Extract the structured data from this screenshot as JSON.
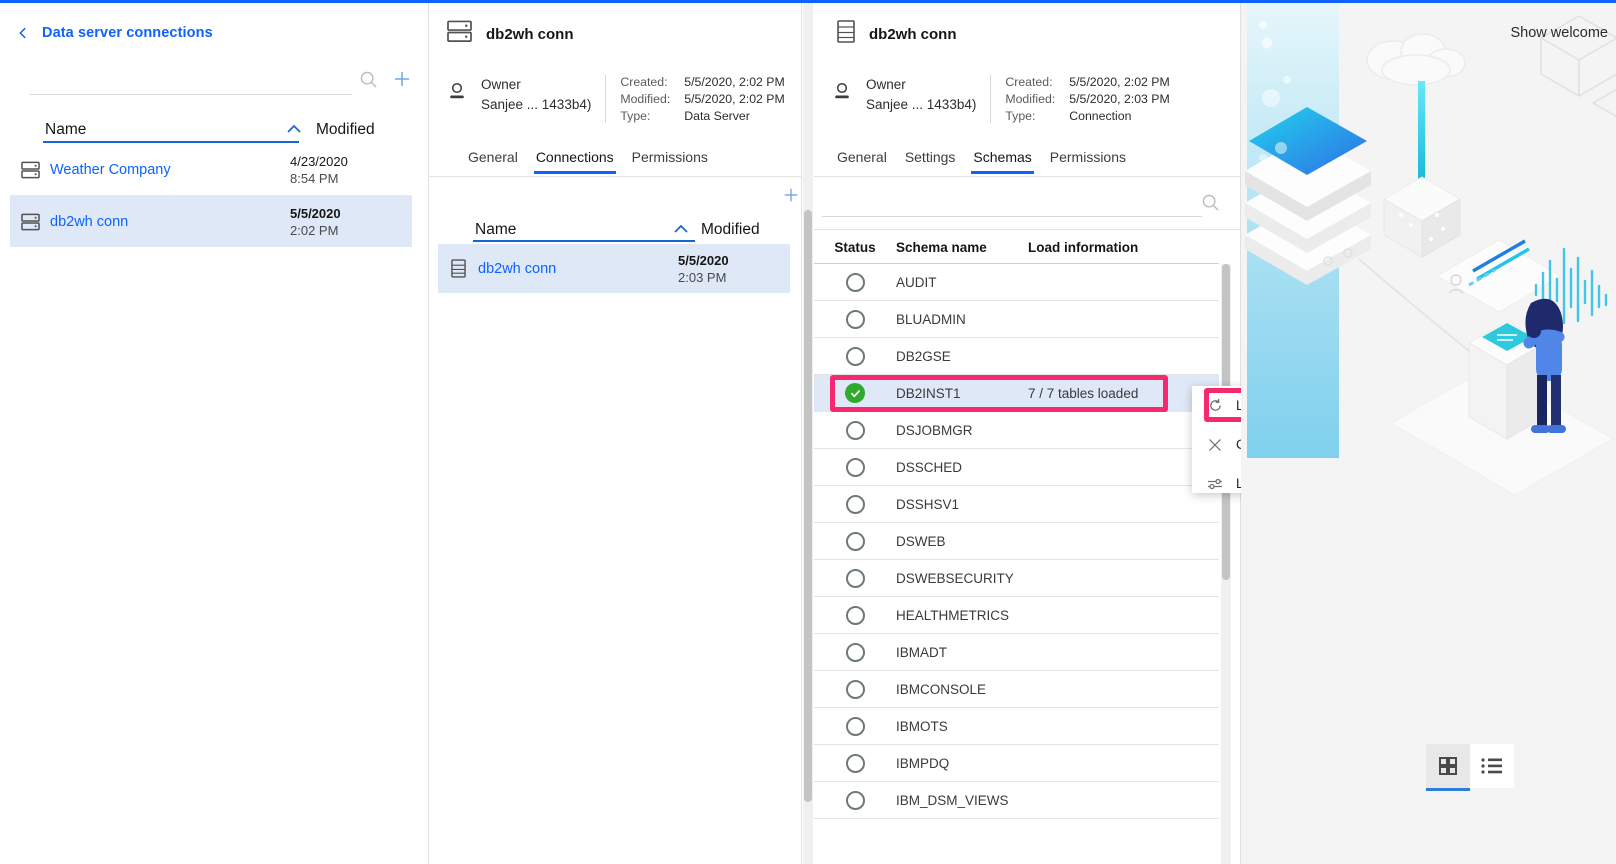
{
  "accent": {
    "blue": "#0f62fe",
    "highlight_pink": "#f6286e",
    "row_select": "#dfe8f7",
    "status_green": "#2faa2f"
  },
  "panel_connections": {
    "breadcrumb_label": "Data server connections",
    "search_placeholder": "",
    "search_value": "",
    "columns": {
      "name": "Name",
      "modified": "Modified"
    },
    "rows": [
      {
        "icon": "data-server-icon",
        "name": "Weather Company",
        "date": "4/23/2020",
        "time": "8:54 PM",
        "selected": false
      },
      {
        "icon": "data-server-icon",
        "name": "db2wh conn",
        "date": "5/5/2020",
        "time": "2:02 PM",
        "selected": true
      }
    ]
  },
  "panel_dataserver": {
    "title": "db2wh conn",
    "owner_label": "Owner",
    "owner_value": "Sanjee ... 1433b4)",
    "meta": [
      {
        "key": "Created:",
        "value": "5/5/2020, 2:02 PM"
      },
      {
        "key": "Modified:",
        "value": "5/5/2020, 2:02 PM"
      },
      {
        "key": "Type:",
        "value": "Data Server"
      }
    ],
    "tabs": [
      {
        "label": "General",
        "active": false
      },
      {
        "label": "Connections",
        "active": true
      },
      {
        "label": "Permissions",
        "active": false
      }
    ],
    "columns": {
      "name": "Name",
      "modified": "Modified"
    },
    "rows": [
      {
        "icon": "connection-icon",
        "name": "db2wh conn",
        "date": "5/5/2020",
        "time": "2:03 PM",
        "selected": true
      }
    ]
  },
  "panel_connection": {
    "title": "db2wh conn",
    "owner_label": "Owner",
    "owner_value": "Sanjee ... 1433b4)",
    "meta": [
      {
        "key": "Created:",
        "value": "5/5/2020, 2:02 PM"
      },
      {
        "key": "Modified:",
        "value": "5/5/2020, 2:03 PM"
      },
      {
        "key": "Type:",
        "value": "Connection"
      }
    ],
    "tabs": [
      {
        "label": "General",
        "active": false
      },
      {
        "label": "Settings",
        "active": false
      },
      {
        "label": "Schemas",
        "active": true
      },
      {
        "label": "Permissions",
        "active": false
      }
    ],
    "search_value": "",
    "columns": {
      "status": "Status",
      "schema_name": "Schema name",
      "load_information": "Load information"
    },
    "schemas": [
      {
        "name": "AUDIT",
        "status": "not-loaded",
        "load": ""
      },
      {
        "name": "BLUADMIN",
        "status": "not-loaded",
        "load": ""
      },
      {
        "name": "DB2GSE",
        "status": "not-loaded",
        "load": ""
      },
      {
        "name": "DB2INST1",
        "status": "loaded",
        "load": "7 / 7 tables loaded",
        "highlighted": true
      },
      {
        "name": "DSJOBMGR",
        "status": "not-loaded",
        "load": ""
      },
      {
        "name": "DSSCHED",
        "status": "not-loaded",
        "load": ""
      },
      {
        "name": "DSSHSV1",
        "status": "not-loaded",
        "load": ""
      },
      {
        "name": "DSWEB",
        "status": "not-loaded",
        "load": ""
      },
      {
        "name": "DSWEBSECURITY",
        "status": "not-loaded",
        "load": ""
      },
      {
        "name": "HEALTHMETRICS",
        "status": "not-loaded",
        "load": ""
      },
      {
        "name": "IBMADT",
        "status": "not-loaded",
        "load": ""
      },
      {
        "name": "IBMCONSOLE",
        "status": "not-loaded",
        "load": ""
      },
      {
        "name": "IBMOTS",
        "status": "not-loaded",
        "load": ""
      },
      {
        "name": "IBMPDQ",
        "status": "not-loaded",
        "load": ""
      },
      {
        "name": "IBM_DSM_VIEWS",
        "status": "not-loaded",
        "load": ""
      }
    ]
  },
  "context_menu": {
    "items": [
      {
        "icon": "refresh-icon",
        "label": "Load metadata",
        "highlighted": true
      },
      {
        "icon": "close-x-icon",
        "label": "Clear metadata",
        "highlighted": false
      },
      {
        "icon": "sliders-icon",
        "label": "Load options",
        "highlighted": false
      }
    ]
  },
  "welcome": {
    "show_welcome_label": "Show welcome"
  },
  "view_toggle": [
    {
      "icon": "grid-view-icon",
      "active": true
    },
    {
      "icon": "list-view-icon",
      "active": false
    }
  ]
}
